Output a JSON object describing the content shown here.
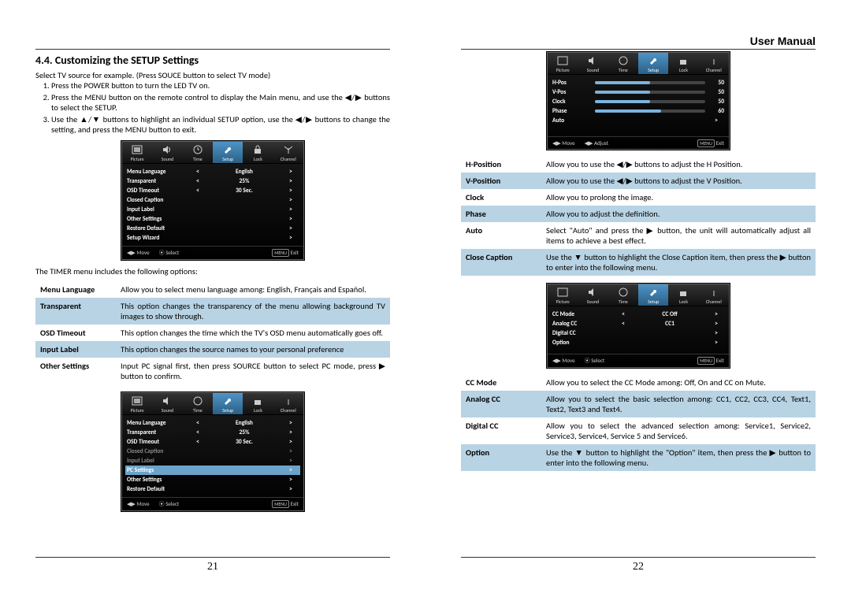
{
  "header": {
    "doc_title": "User Manual"
  },
  "footer": {
    "page_left": "21",
    "page_right": "22"
  },
  "left": {
    "section_number_title": "4.4. Customizing the SETUP Settings",
    "intro": "Select TV source for example. (Press SOUCE button to select TV mode)",
    "steps": [
      "Press the POWER button to turn the LED TV on.",
      "Press the MENU button on the remote control to display the Main menu, and use the  ◀/▶  buttons to select the SETUP.",
      "Use the ▲/▼ buttons to highlight an individual SETUP option, use the ◀/▶ buttons to change the setting, and press the MENU button to exit."
    ],
    "timer_sentence": "The TIMER menu includes the following options:",
    "defs": [
      {
        "k": "Menu Language",
        "v": "Allow you to select menu language among: English, Français and Español.",
        "shade": false
      },
      {
        "k": "Transparent",
        "v": "This option changes the transparency of the menu allowing background TV images to show through.",
        "shade": true
      },
      {
        "k": "OSD Timeout",
        "v": "This option changes the time which the TV's OSD menu automatically goes off.",
        "shade": false
      },
      {
        "k": "Input Label",
        "v": "This option changes the source names to your personal preference",
        "shade": true
      },
      {
        "k": "Other Settings",
        "v": "Input PC signal first, then press SOURCE button to select PC mode, press ▶ button to confirm.",
        "shade": false
      }
    ]
  },
  "right": {
    "defs_top": [
      {
        "k": "H-Position",
        "v": "Allow you to use the ◀/▶ buttons to adjust the H Position.",
        "shade": false
      },
      {
        "k": "V-Position",
        "v": "Allow you to use the ◀/▶ buttons to adjust the V Position.",
        "shade": true
      },
      {
        "k": "Clock",
        "v": "Allow you to prolong the image.",
        "shade": false
      },
      {
        "k": "Phase",
        "v": "Allow you to adjust the definition.",
        "shade": true
      },
      {
        "k": "Auto",
        "v": "Select \"Auto\" and press the ▶ button, the unit will automatically adjust all items to achieve a best effect.",
        "shade": false
      },
      {
        "k": "Close Caption",
        "v": "Use the ▼ button to highlight the Close Caption item, then press the ▶ button to enter into the following menu.",
        "shade": true
      }
    ],
    "defs_bot": [
      {
        "k": "CC Mode",
        "v": "Allow you to select the CC Mode among: Off, On and CC on Mute.",
        "shade": false
      },
      {
        "k": "Analog CC",
        "v": "Allow you to select the basic selection among: CC1, CC2, CC3, CC4, Text1, Text2, Text3 and Text4.",
        "shade": true
      },
      {
        "k": "Digital CC",
        "v": "Allow you to select the advanced selection among: Service1, Service2, Service3, Service4, Service 5 and Service6.",
        "shade": false
      },
      {
        "k": "Option",
        "v": "Use the ▼ button to highlight the \"Option\" item, then press the ▶ button to enter into the following menu.",
        "shade": true
      }
    ]
  },
  "osd_tabs": [
    "Picture",
    "Sound",
    "Time",
    "Setup",
    "Lock",
    "Channel"
  ],
  "osd_foot": {
    "move": "Move",
    "select": "Select",
    "adjust": "Adjust",
    "exit": "Exit",
    "menu_key": "MENU",
    "sel_key": "⦿"
  },
  "osd1": {
    "rows": [
      {
        "c1": "Menu Language",
        "c3": "English"
      },
      {
        "c1": "Transparent",
        "c3": "25%"
      },
      {
        "c1": "OSD Timeout",
        "c3": "30 Sec."
      },
      {
        "c1": "Closed Caption",
        "c3": ""
      },
      {
        "c1": "Input Label",
        "c3": ""
      },
      {
        "c1": "Other Settings",
        "c3": ""
      },
      {
        "c1": "Restore Default",
        "c3": ""
      },
      {
        "c1": "Setup Wizard",
        "c3": ""
      }
    ]
  },
  "osd2": {
    "rows": [
      {
        "c1": "Menu Language",
        "c3": "English"
      },
      {
        "c1": "Transparent",
        "c3": "25%"
      },
      {
        "c1": "OSD Timeout",
        "c3": "30 Sec."
      },
      {
        "c1": "Closed Caption",
        "c3": "",
        "dim": true
      },
      {
        "c1": "Input Label",
        "c3": "",
        "dim": true
      },
      {
        "c1": "PC Settings",
        "c3": "",
        "highlight": true
      },
      {
        "c1": "Other Settings",
        "c3": ""
      },
      {
        "c1": "Restore Default",
        "c3": ""
      }
    ]
  },
  "osd3": {
    "sliders": [
      {
        "label": "H-Pos",
        "val": "50",
        "pct": 50
      },
      {
        "label": "V-Pos",
        "val": "50",
        "pct": 50
      },
      {
        "label": "Clock",
        "val": "50",
        "pct": 50
      },
      {
        "label": "Phase",
        "val": "60",
        "pct": 60
      }
    ],
    "auto_label": "Auto"
  },
  "osd4": {
    "rows": [
      {
        "c1": "CC Mode",
        "c3": "CC Off"
      },
      {
        "c1": "Analog CC",
        "c3": "CC1"
      },
      {
        "c1": "Digital CC",
        "c3": ""
      },
      {
        "c1": "Option",
        "c3": ""
      }
    ]
  },
  "icons": {
    "tri_l": "◀",
    "tri_r": "▶",
    "tri_u": "▲",
    "tri_d": "▼",
    "arrows_lr": "◀/▶"
  }
}
